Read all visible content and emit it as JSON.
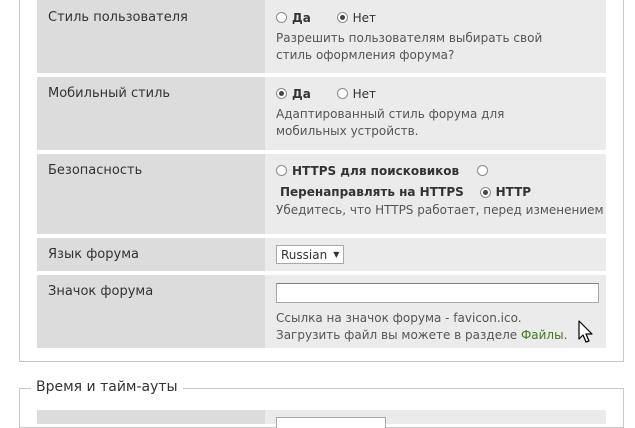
{
  "settings": {
    "user_style": {
      "label": "Стиль пользователя",
      "options": [
        "Да",
        "Нет"
      ],
      "selected": "Нет",
      "description": "Разрешить пользователям выбирать свой стиль оформления форума?"
    },
    "mobile_style": {
      "label": "Мобильный стиль",
      "options": [
        "Да",
        "Нет"
      ],
      "selected": "Да",
      "description": "Адаптированный стиль форума для мобильных устройств."
    },
    "security": {
      "label": "Безопасность",
      "options": [
        "HTTPS для поисковиков",
        "Перенаправлять на HTTPS",
        "HTTP"
      ],
      "selected": "HTTP",
      "description": "Убедитесь, что HTTPS работает, перед изменением"
    },
    "language": {
      "label": "Язык форума",
      "selected_value": "Russian"
    },
    "forum_icon": {
      "label": "Значок форума",
      "value": "",
      "description_before": "Ссылка на значок форума - favicon.ico. Загрузить файл вы можете в разделе ",
      "link_text": "Файлы",
      "description_after": "."
    }
  },
  "next_section": {
    "legend": "Время и тайм-ауты"
  }
}
